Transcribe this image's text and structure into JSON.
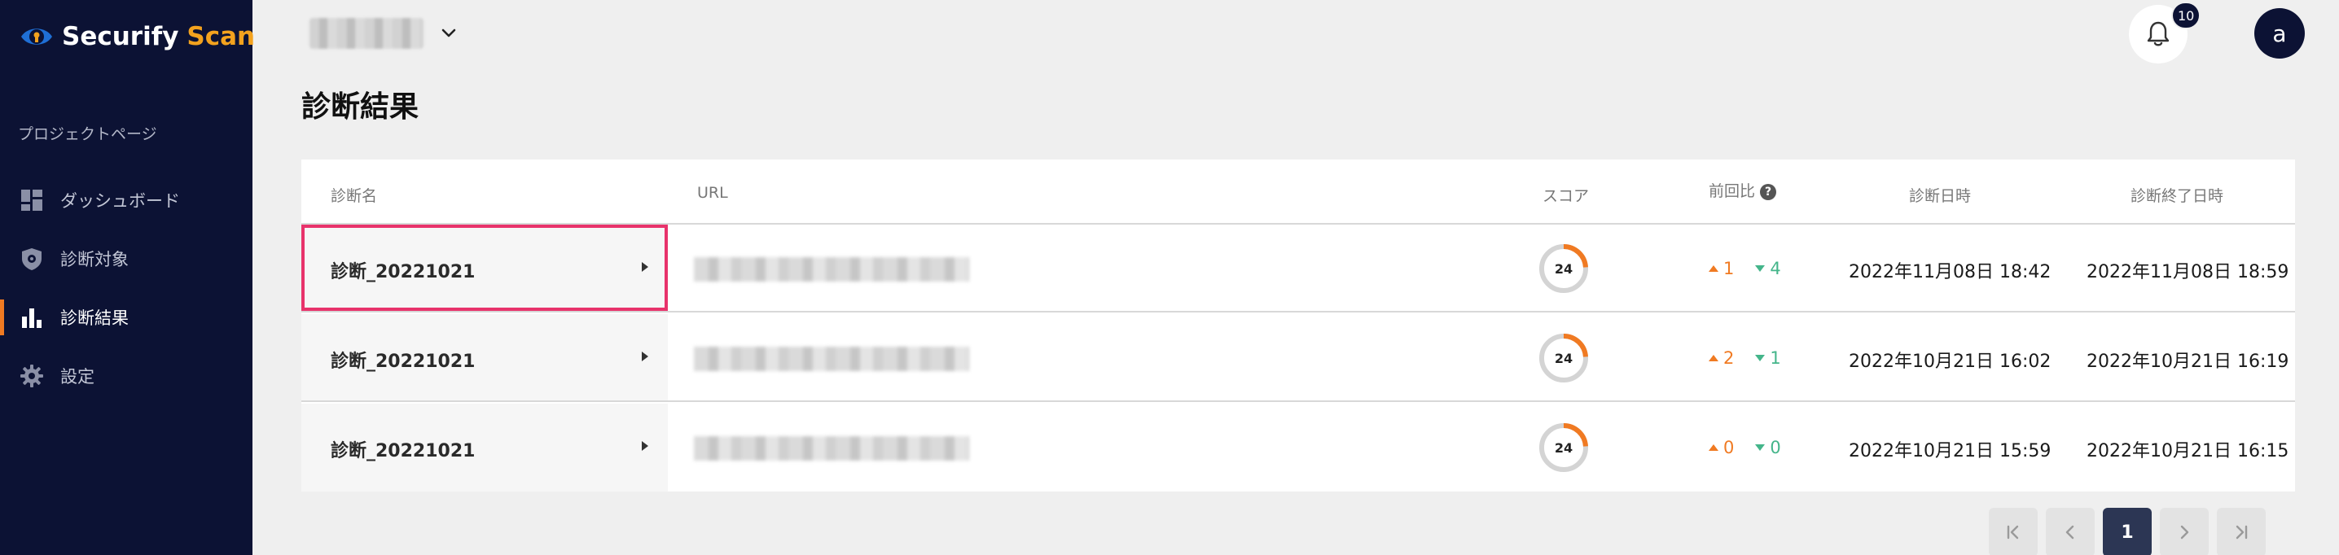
{
  "app": {
    "logo_primary": "Securify",
    "logo_secondary": "Scan",
    "brand_color": "#0c1234",
    "accent_color": "#f3a21e"
  },
  "sidebar": {
    "section_label": "プロジェクトページ",
    "items": [
      {
        "label": "ダッシュボード",
        "icon": "dashboard-icon",
        "active": false
      },
      {
        "label": "診断対象",
        "icon": "shield-target-icon",
        "active": false
      },
      {
        "label": "診断結果",
        "icon": "bar-chart-icon",
        "active": true
      },
      {
        "label": "設定",
        "icon": "gear-icon",
        "active": false
      }
    ]
  },
  "header": {
    "notification_count": "10",
    "avatar_initial": "a"
  },
  "page": {
    "title": "診断結果"
  },
  "table": {
    "columns": {
      "name": "診断名",
      "url": "URL",
      "score": "スコア",
      "delta": "前回比",
      "delta_help": "?",
      "diag_date": "診断日時",
      "end_date": "診断終了日時"
    },
    "rows": [
      {
        "name": "診断_20221021",
        "score": "24",
        "score_fraction": 0.24,
        "up": "1",
        "down": "4",
        "diag_date": "2022年11月08日 18:42",
        "end_date": "2022年11月08日 18:59",
        "highlighted": true
      },
      {
        "name": "診断_20221021",
        "score": "24",
        "score_fraction": 0.24,
        "up": "2",
        "down": "1",
        "diag_date": "2022年10月21日 16:02",
        "end_date": "2022年10月21日 16:19",
        "highlighted": false
      },
      {
        "name": "診断_20221021",
        "score": "24",
        "score_fraction": 0.24,
        "up": "0",
        "down": "0",
        "diag_date": "2022年10月21日 15:59",
        "end_date": "2022年10月21日 16:15",
        "highlighted": false
      }
    ]
  },
  "pagination": {
    "current_page": "1"
  },
  "colors": {
    "up": "#f07a22",
    "down": "#44b58a",
    "highlight": "#e8336b"
  }
}
